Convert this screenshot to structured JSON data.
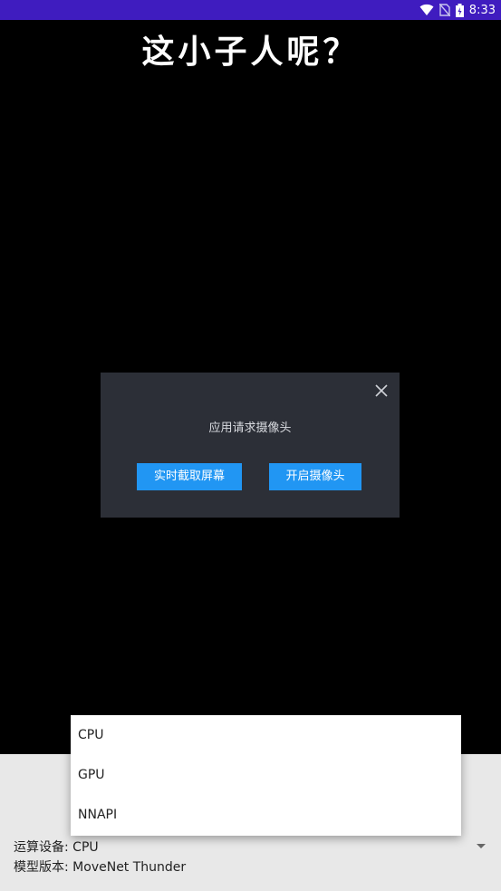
{
  "status_bar": {
    "time": "8:33",
    "icons": [
      "wifi-icon",
      "no-sim-icon",
      "battery-icon"
    ],
    "background": "#3f1cbf"
  },
  "headline": "这小子人呢？",
  "dialog": {
    "message": "应用请求摄像头",
    "close_icon": "close-icon",
    "buttons": [
      {
        "label": "实时截取屏幕"
      },
      {
        "label": "开启摄像头"
      }
    ],
    "accent": "#2196f3"
  },
  "settings": {
    "device_label": "运算设备:",
    "device_value": "CPU",
    "model_label": "模型版本:",
    "model_value": "MoveNet Thunder"
  },
  "dropdown": {
    "options": [
      "CPU",
      "GPU",
      "NNAPI"
    ]
  }
}
